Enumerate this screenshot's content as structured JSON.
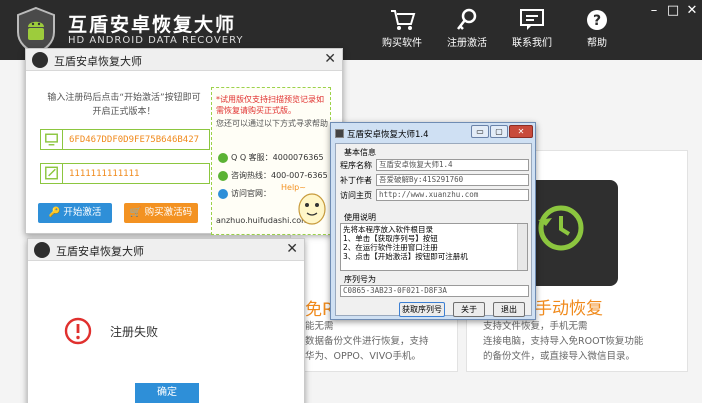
{
  "app": {
    "title": "互盾安卓恢复大师",
    "subtitle": "HD ANDROID DATA RECOVERY"
  },
  "nav": [
    {
      "label": "购买软件",
      "icon": "cart-icon"
    },
    {
      "label": "注册激活",
      "icon": "key-icon"
    },
    {
      "label": "联系我们",
      "icon": "chat-icon"
    },
    {
      "label": "帮助",
      "icon": "help-icon"
    }
  ],
  "window_controls": {
    "minimize": "–",
    "restore": "□",
    "close": "✕"
  },
  "cards": {
    "card2": {
      "title_fragment": "免R",
      "desc": [
        "能无需",
        "数据备份文件进行恢复，支持",
        "华为、OPPO、VIVO手机。"
      ]
    },
    "card3": {
      "title": "手动恢复",
      "desc": [
        "支持文件恢复，手机无需",
        "连接电脑，支持导入免ROOT恢复功能",
        "的备份文件，或直接导入微信目录。"
      ]
    }
  },
  "activation_dialog": {
    "title": "互盾安卓恢复大师",
    "instruction": "输入注册码后点击“开始激活”按钮即可开启正式版本！",
    "machine_code": "6FD467DDF0D9FE75B646B427",
    "reg_code": "1111111111111",
    "activate_label": "开始激活",
    "buy_label": "购买激活码",
    "notice_red": "*试用版仅支持扫描预览记录如需恢复请购买正式版。",
    "notice_gray": "您还可以通过以下方式寻求帮助",
    "contacts": [
      {
        "label": "Q Q 客服：4000076365",
        "icon": "qq-icon"
      },
      {
        "label": "咨询热线：400-007-6365",
        "icon": "phone-icon"
      },
      {
        "label": "访问官网：",
        "icon": "ie-icon"
      }
    ],
    "mascot_text": "Help~",
    "url": "anzhuo.huifudashi.com"
  },
  "failure_dialog": {
    "title": "互盾安卓恢复大师",
    "message": "注册失败",
    "ok_label": "确定"
  },
  "about_dialog": {
    "title": "互盾安卓恢复大师1.4",
    "section_basic": "基本信息",
    "name_label": "程序名称",
    "name_value": "互盾安卓恢复大师1.4",
    "author_label": "补丁作者",
    "author_value": "吾爱破解By:41S291760",
    "home_label": "访问主页",
    "home_value": "http://www.xuanzhu.com",
    "usage_label": "使用说明",
    "usage_lines": [
      "先将本程序放入软件根目录",
      "1、单击【获取序列号】按钮",
      "2、在运行软件注册窗口注册",
      "3、点击【开始激活】按钮即可注册机"
    ],
    "serial_label": "序列号为",
    "serial_value": "C0865-3AB23-0F021-D8F3A",
    "get_serial_label": "获取序列号",
    "about_label": "关于",
    "exit_label": "退出",
    "min_label": "▭",
    "max_label": "▢",
    "close_label": "✕"
  },
  "colors": {
    "accent_orange": "#f08a1c",
    "accent_blue": "#2e8fd8",
    "accent_green": "#8cc63f",
    "error_red": "#e0302e"
  }
}
